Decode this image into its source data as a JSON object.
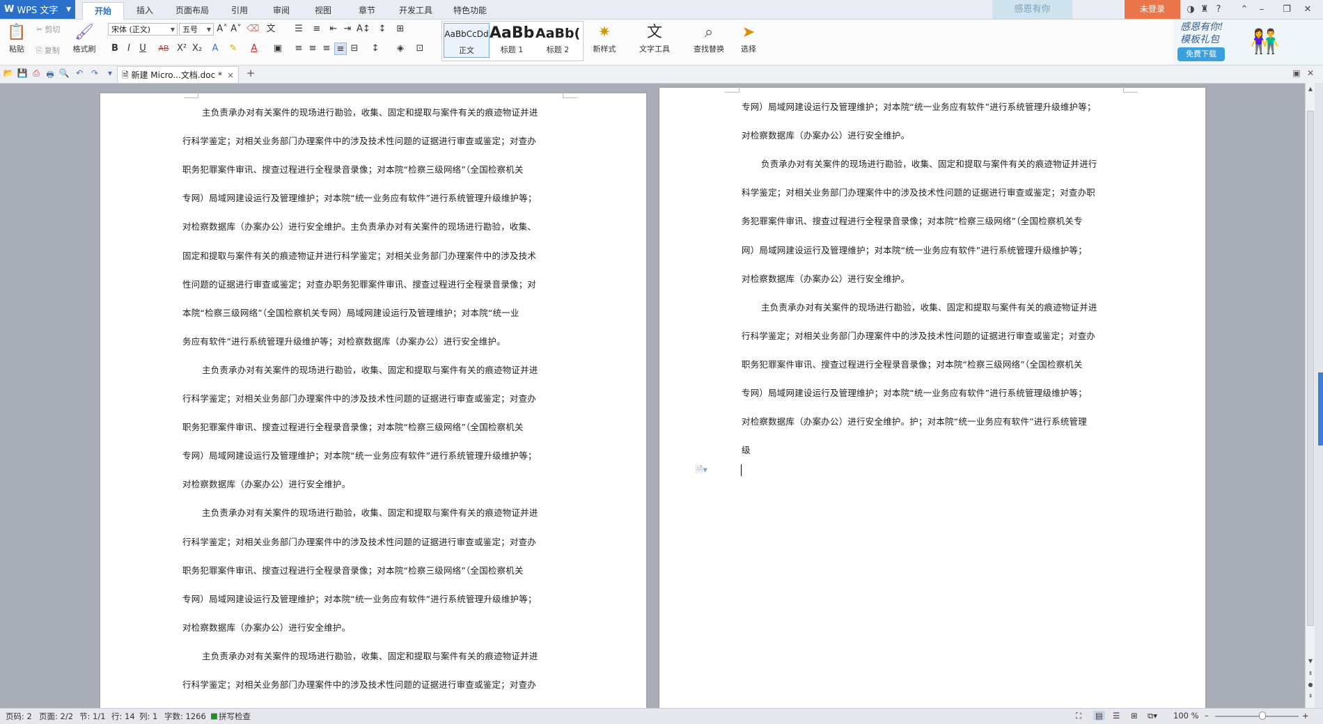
{
  "app": {
    "name": "WPS 文字"
  },
  "ribbon_tabs": [
    "开始",
    "插入",
    "页面布局",
    "引用",
    "审阅",
    "视图",
    "章节",
    "开发工具",
    "特色功能"
  ],
  "top_right": {
    "thanks": "感恩有你",
    "login": "未登录"
  },
  "clipboard": {
    "paste": "粘贴",
    "cut": "剪切",
    "copy": "复制",
    "format_painter": "格式刷"
  },
  "font": {
    "family": "宋体 (正文)",
    "size": "五号"
  },
  "styles": [
    {
      "sample": "AaBbCcDd",
      "name": "正文"
    },
    {
      "sample": "AaBb",
      "name": "标题 1"
    },
    {
      "sample": "AaBb(",
      "name": "标题 2"
    }
  ],
  "ribbon_buttons": {
    "new_style": "新样式",
    "text_tools": "文字工具",
    "find_replace": "查找替换",
    "select": "选择"
  },
  "promo": {
    "line1": "感恩有你!",
    "line2": "模板礼包",
    "download": "免费下载"
  },
  "document_tab": {
    "title": "新建 Micro...文档.doc *"
  },
  "page_left_lines": [
    "主负责承办对有关案件的现场进行勘验，收集、固定和提取与案件有关的痕迹物证并进",
    "行科学鉴定；对相关业务部门办理案件中的涉及技术性问题的证据进行审查或鉴定；对查办",
    "职务犯罪案件审讯、搜查过程进行全程录音录像；对本院“检察三级网络”（全国检察机关",
    "专网）局域网建设运行及管理维护；对本院“统一业务应有软件”进行系统管理升级维护等；",
    "对检察数据库（办案办公）进行安全维护。主负责承办对有关案件的现场进行勘验，收集、",
    "固定和提取与案件有关的痕迹物证并进行科学鉴定；对相关业务部门办理案件中的涉及技术",
    "性问题的证据进行审查或鉴定；对查办职务犯罪案件审讯、搜查过程进行全程录音录像；对",
    "本院“检察三级网络”（全国检察机关专网）局域网建设运行及管理维护；对本院“统一业",
    "务应有软件”进行系统管理升级维护等；对检察数据库（办案办公）进行安全维护。",
    "主负责承办对有关案件的现场进行勘验，收集、固定和提取与案件有关的痕迹物证并进",
    "行科学鉴定；对相关业务部门办理案件中的涉及技术性问题的证据进行审查或鉴定；对查办",
    "职务犯罪案件审讯、搜查过程进行全程录音录像；对本院“检察三级网络”（全国检察机关",
    "专网）局域网建设运行及管理维护；对本院“统一业务应有软件”进行系统管理升级维护等；",
    "对检察数据库（办案办公）进行安全维护。",
    "主负责承办对有关案件的现场进行勘验，收集、固定和提取与案件有关的痕迹物证并进",
    "行科学鉴定；对相关业务部门办理案件中的涉及技术性问题的证据进行审查或鉴定；对查办",
    "职务犯罪案件审讯、搜查过程进行全程录音录像；对本院“检察三级网络”（全国检察机关",
    "专网）局域网建设运行及管理维护；对本院“统一业务应有软件”进行系统管理升级维护等；",
    "对检察数据库（办案办公）进行安全维护。",
    "主负责承办对有关案件的现场进行勘验，收集、固定和提取与案件有关的痕迹物证并进",
    "行科学鉴定；对相关业务部门办理案件中的涉及技术性问题的证据进行审查或鉴定；对查办"
  ],
  "page_right_lines": [
    "专网）局域网建设运行及管理维护；对本院“统一业务应有软件”进行系统管理升级维护等；",
    "对检察数据库（办案办公）进行安全维护。",
    "负责承办对有关案件的现场进行勘验，收集、固定和提取与案件有关的痕迹物证并进行",
    "科学鉴定；对相关业务部门办理案件中的涉及技术性问题的证据进行审查或鉴定；对查办职",
    "务犯罪案件审讯、搜查过程进行全程录音录像；对本院“检察三级网络”（全国检察机关专",
    "网）局域网建设运行及管理维护；对本院“统一业务应有软件”进行系统管理升级维护等；",
    "对检察数据库（办案办公）进行安全维护。",
    "主负责承办对有关案件的现场进行勘验，收集、固定和提取与案件有关的痕迹物证并进",
    "行科学鉴定；对相关业务部门办理案件中的涉及技术性问题的证据进行审查或鉴定；对查办",
    "职务犯罪案件审讯、搜查过程进行全程录音录像；对本院“检察三级网络”（全国检察机关",
    "专网）局域网建设运行及管理维护；对本院“统一业务应有软件”进行系统管理级维护等；",
    "对检察数据库（办案办公）进行安全维护。护；对本院“统一业务应有软件”进行系统管理",
    "级"
  ],
  "status": {
    "page_num": "页码: 2",
    "pages": "页面: 2/2",
    "section": "节: 1/1",
    "row": "行: 14",
    "col": "列: 1",
    "word_count": "字数: 1266",
    "spell_check": "拼写检查",
    "zoom": "100 %"
  },
  "colors": {
    "accent": "#2a6fc9",
    "login": "#e8764a",
    "page_bg": "#a9adb6"
  }
}
